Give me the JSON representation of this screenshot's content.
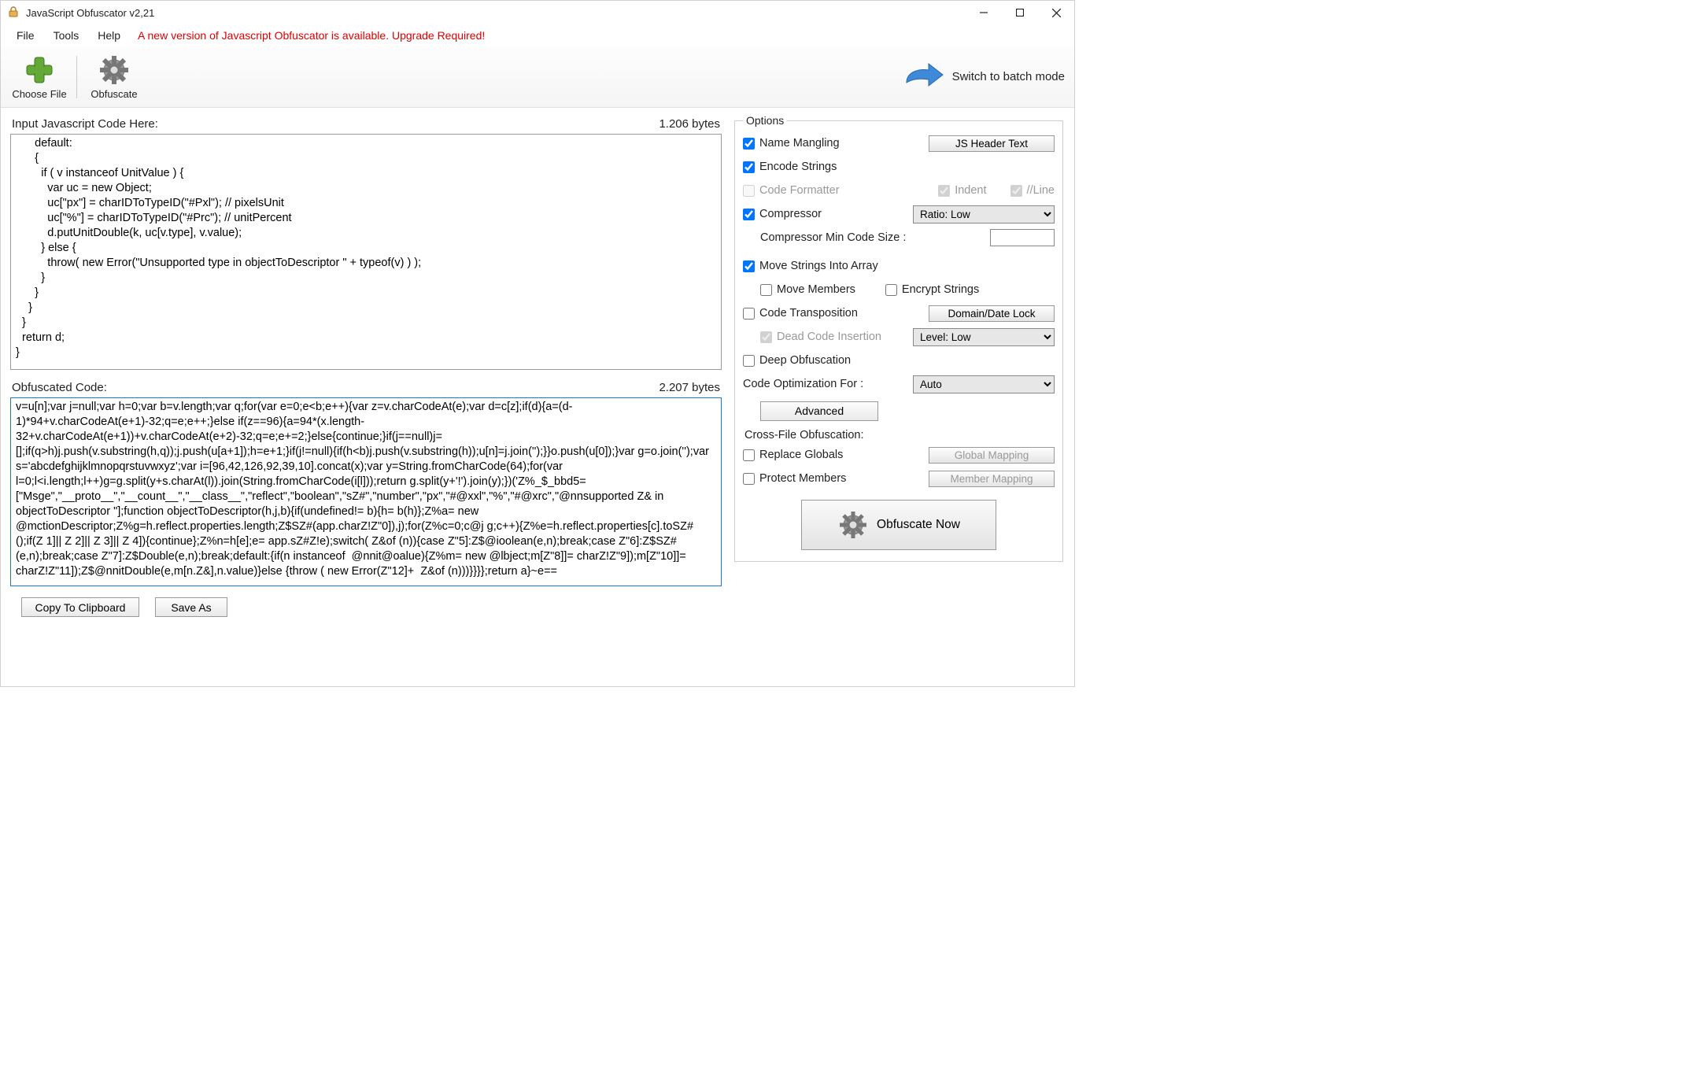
{
  "window": {
    "title": "JavaScript Obfuscator v2,21"
  },
  "menubar": {
    "file": "File",
    "tools": "Tools",
    "help": "Help",
    "upgrade": "A new version of Javascript Obfuscator is available. Upgrade Required!"
  },
  "toolbar": {
    "chooseFile": "Choose File",
    "obfuscate": "Obfuscate",
    "batch": "Switch to batch mode"
  },
  "left": {
    "inputLabel": "Input Javascript Code Here:",
    "inputBytes": "1.206 bytes",
    "inputCode": "      default:\n      {\n        if ( v instanceof UnitValue ) {\n          var uc = new Object;\n          uc[\"px\"] = charIDToTypeID(\"#Pxl\"); // pixelsUnit\n          uc[\"%\"] = charIDToTypeID(\"#Prc\"); // unitPercent\n          d.putUnitDouble(k, uc[v.type], v.value);\n        } else {\n          throw( new Error(\"Unsupported type in objectToDescriptor \" + typeof(v) ) );\n        }\n      }\n    }\n  }\n  return d;\n}",
    "outputLabel": "Obfuscated Code:",
    "outputBytes": "2.207 bytes",
    "outputCode": "v=u[n];var j=null;var h=0;var b=v.length;var q;for(var e=0;e<b;e++){var z=v.charCodeAt(e);var d=c[z];if(d){a=(d-1)*94+v.charCodeAt(e+1)-32;q=e;e++;}else if(z==96){a=94*(x.length-32+v.charCodeAt(e+1))+v.charCodeAt(e+2)-32;q=e;e+=2;}else{continue;}if(j==null)j=[];if(q>h)j.push(v.substring(h,q));j.push(u[a+1]);h=e+1;}if(j!=null){if(h<b)j.push(v.substring(h));u[n]=j.join('');}}o.push(u[0]);}var g=o.join('');var s='abcdefghijklmnopqrstuvwxyz';var i=[96,42,126,92,39,10].concat(x);var y=String.fromCharCode(64);for(var l=0;l<i.length;l++)g=g.split(y+s.charAt(l)).join(String.fromCharCode(i[l]));return g.split(y+'!').join(y);})('Z%_$_bbd5=[\"Msge\",\"__proto__\",\"__count__\",\"__class__\",\"reflect\",\"boolean\",\"sZ#\",\"number\",\"px\",\"#@xxl\",\"%\",\"#@xrc\",\"@nnsupported Z& in objectToDescriptor \"];function objectToDescriptor(h,j,b){if(undefined!= b){h= b(h)};Z%a= new @mctionDescriptor;Z%g=h.reflect.properties.length;Z$SZ#(app.charZ!Z\"0]),j);for(Z%c=0;c@j g;c++){Z%e=h.reflect.properties[c].toSZ#();if(Z 1]|| Z 2]|| Z 3]|| Z 4]){continue};Z%n=h[e];e= app.sZ#Z!e);switch( Z&of (n)){case Z\"5]:Z$@ioolean(e,n);break;case Z\"6]:Z$SZ#(e,n);break;case Z\"7]:Z$Double(e,n);break;default:{if(n instanceof  @nnit@oalue){Z%m= new @lbject;m[Z\"8]]= charZ!Z\"9]);m[Z\"10]]= charZ!Z\"11]);Z$@nnitDouble(e,m[n.Z&],n.value)}else {throw ( new Error(Z\"12]+  Z&of (n)))}}}};return a}~e==",
    "copyBtn": "Copy To Clipboard",
    "saveBtn": "Save As"
  },
  "options": {
    "legend": "Options",
    "nameMangling": "Name Mangling",
    "jsHeader": "JS Header Text",
    "encodeStrings": "Encode Strings",
    "codeFormatter": "Code Formatter",
    "indent": "Indent",
    "line": "//Line",
    "compressor": "Compressor",
    "ratioSelected": "Ratio: Low",
    "compMinLabel": "Compressor Min Code Size :",
    "compMinValue": "",
    "moveStrings": "Move Strings Into Array",
    "moveMembers": "Move Members",
    "encryptStrings": "Encrypt Strings",
    "codeTransposition": "Code Transposition",
    "domainDate": "Domain/Date Lock",
    "deadCode": "Dead Code Insertion",
    "levelSelected": "Level: Low",
    "deepObf": "Deep Obfuscation",
    "codeOptFor": "Code Optimization For :",
    "codeOptSelected": "Auto",
    "advanced": "Advanced",
    "crossFile": "Cross-File Obfuscation:",
    "replaceGlobals": "Replace Globals",
    "globalMapping": "Global Mapping",
    "protectMembers": "Protect Members",
    "memberMapping": "Member Mapping",
    "obfNow": "Obfuscate Now"
  }
}
